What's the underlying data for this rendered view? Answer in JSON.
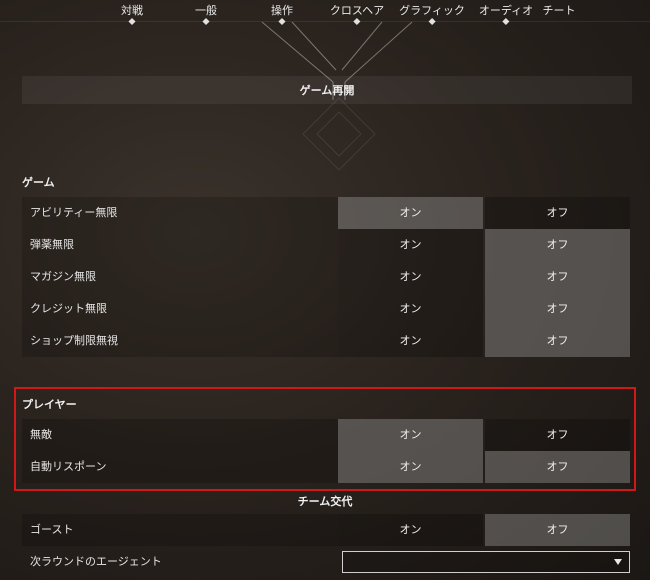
{
  "tabs": [
    "対戦",
    "一般",
    "操作",
    "クロスヘア",
    "グラフィック",
    "オーディオ",
    "チート"
  ],
  "resume_label": "ゲーム再開",
  "sections": [
    {
      "title": "ゲーム",
      "rows": [
        {
          "label": "アビリティー無限",
          "on": "オン",
          "off": "オフ",
          "selected": "on"
        },
        {
          "label": "弾薬無限",
          "on": "オン",
          "off": "オフ",
          "selected": "off"
        },
        {
          "label": "マガジン無限",
          "on": "オン",
          "off": "オフ",
          "selected": "off"
        },
        {
          "label": "クレジット無限",
          "on": "オン",
          "off": "オフ",
          "selected": "off"
        },
        {
          "label": "ショップ制限無視",
          "on": "オン",
          "off": "オフ",
          "selected": "off"
        }
      ]
    },
    {
      "title": "プレイヤー",
      "rows": [
        {
          "label": "無敵",
          "on": "オン",
          "off": "オフ",
          "selected": "on"
        },
        {
          "label": "自動リスポーン",
          "on": "オン",
          "off": "オフ",
          "selected": "on"
        }
      ]
    }
  ],
  "team_swap_label": "チーム交代",
  "ghost": {
    "label": "ゴースト",
    "on": "オン",
    "off": "オフ",
    "selected": "off"
  },
  "next_agent": {
    "label": "次ラウンドのエージェント",
    "value": ""
  },
  "colors": {
    "highlight_border": "#d01818",
    "selected_option": "#8a8a8a"
  }
}
